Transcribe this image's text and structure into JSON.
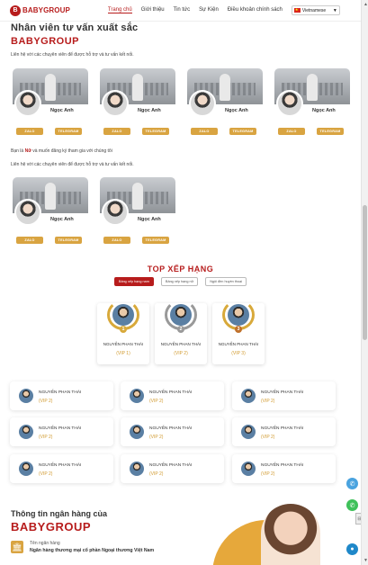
{
  "header": {
    "logo_badge": "B",
    "logo_text": "BABYGROUP",
    "nav": [
      "Trang chủ",
      "Giới thiệu",
      "Tin tức",
      "Sự Kiện",
      "Điều khoản chính sách"
    ],
    "language": "Vietnamese"
  },
  "consultants": {
    "title": "Nhân viên tư vấn xuất sắc",
    "brand": "BABYGROUP",
    "description": "Liên hệ với các chuyên viên để được hỗ trợ và tư vấn kết nối.",
    "group1": [
      {
        "name": "Ngọc Anh",
        "zalo": "ZALO",
        "telegram": "TELEGRAM"
      },
      {
        "name": "Ngọc Anh",
        "zalo": "ZALO",
        "telegram": "TELEGRAM"
      },
      {
        "name": "Ngọc Anh",
        "zalo": "ZALO",
        "telegram": "TELEGRAM"
      },
      {
        "name": "Ngọc Anh",
        "zalo": "ZALO",
        "telegram": "TELEGRAM"
      }
    ],
    "female_prefix": "Bạn là",
    "female_highlight": "Nữ",
    "female_suffix": "và muốn đăng ký tham gia với chúng tôi",
    "description2": "Liên hệ với các chuyên viên để được hỗ trợ và tư vấn kết nối.",
    "group2": [
      {
        "name": "Ngọc Anh",
        "zalo": "ZALO",
        "telegram": "TELEGRAM"
      },
      {
        "name": "Ngọc Anh",
        "zalo": "ZALO",
        "telegram": "TELEGRAM"
      }
    ]
  },
  "ranking": {
    "title": "TOP XẾP HẠNG",
    "tabs": [
      "Bảng xếp hạng nam",
      "Bảng xếp hạng nữ",
      "Ngôi đền huyền thoại"
    ],
    "top": [
      {
        "name": "NGUYỄN PHAN THÁI",
        "vip": "(VIP 1)",
        "medal": "1"
      },
      {
        "name": "NGUYỄN PHAN THÁI",
        "vip": "(VIP 2)",
        "medal": "2"
      },
      {
        "name": "NGUYỄN PHAN THÁI",
        "vip": "(VIP 3)",
        "medal": "3"
      }
    ],
    "list": [
      {
        "name": "NGUYỄN PHAN THÁI",
        "vip": "(VIP 2)"
      },
      {
        "name": "NGUYỄN PHAN THÁI",
        "vip": "(VIP 2)"
      },
      {
        "name": "NGUYỄN PHAN THÁI",
        "vip": "(VIP 2)"
      },
      {
        "name": "NGUYỄN PHAN THÁI",
        "vip": "(VIP 2)"
      },
      {
        "name": "NGUYỄN PHAN THÁI",
        "vip": "(VIP 2)"
      },
      {
        "name": "NGUYỄN PHAN THÁI",
        "vip": "(VIP 2)"
      },
      {
        "name": "NGUYỄN PHAN THÁI",
        "vip": "(VIP 2)"
      },
      {
        "name": "NGUYỄN PHAN THÁI",
        "vip": "(VIP 2)"
      },
      {
        "name": "NGUYỄN PHAN THÁI",
        "vip": "(VIP 2)"
      }
    ]
  },
  "bank": {
    "title": "Thông tin ngân hàng của",
    "brand": "BABYGROUP",
    "label": "Tên ngân hàng",
    "value": "Ngân hàng thương mại cổ phần Ngoại thương Việt Nam"
  },
  "icons": {
    "phone": "phone-icon",
    "whatsapp": "whatsapp-icon",
    "messenger": "messenger-icon",
    "bank": "bank-icon"
  },
  "colors": {
    "brand_red": "#b71c1c",
    "gold": "#d9a441"
  }
}
